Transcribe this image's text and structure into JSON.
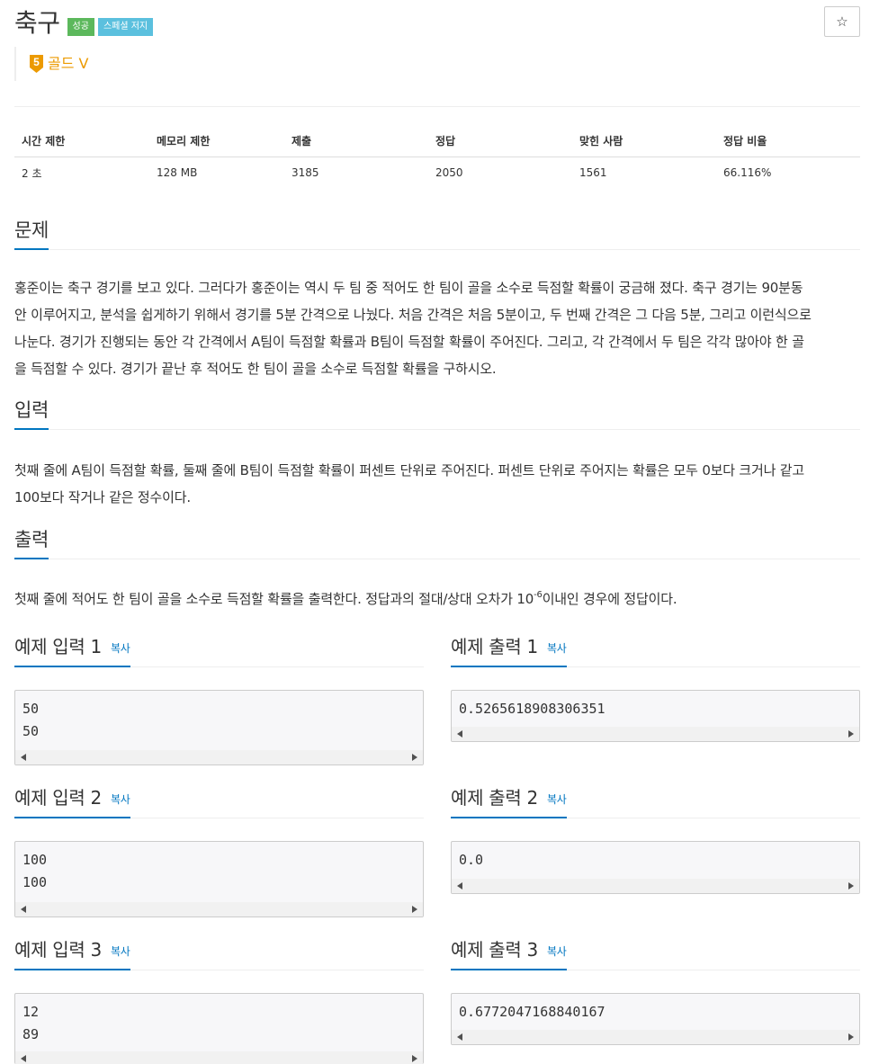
{
  "problem": {
    "title": "축구",
    "badges": {
      "success": "성공",
      "special": "스페셜 저지"
    },
    "tier": {
      "number": "5",
      "label": "골드 V",
      "color": "#ec9a00"
    },
    "star_label": "☆"
  },
  "info": {
    "headers": [
      "시간 제한",
      "메모리 제한",
      "제출",
      "정답",
      "맞힌 사람",
      "정답 비율"
    ],
    "values": [
      "2 초",
      "128 MB",
      "3185",
      "2050",
      "1561",
      "66.116%"
    ]
  },
  "sections": {
    "problem": {
      "title": "문제",
      "lines": [
        "홍준이는 축구 경기를 보고 있다. 그러다가 홍준이는 역시 두 팀 중 적어도 한 팀이 골을 소수로 득점할 확률이 궁금해 졌다. 축구 경기는 90분동",
        "안 이루어지고, 분석을 쉽게하기 위해서 경기를 5분 간격으로 나눴다. 처음 간격은 처음 5분이고, 두 번째 간격은 그 다음 5분, 그리고 이런식으로",
        "나눈다. 경기가 진행되는 동안 각 간격에서 A팀이 득점할 확률과 B팀이 득점할 확률이 주어진다. 그리고, 각 간격에서 두 팀은 각각 많아야 한 골",
        "을 득점할 수 있다. 경기가 끝난 후 적어도 한 팀이 골을 소수로 득점할 확률을 구하시오."
      ]
    },
    "input": {
      "title": "입력",
      "lines": [
        "첫째 줄에 A팀이 득점할 확률, 둘째 줄에 B팀이 득점할 확률이 퍼센트 단위로 주어진다. 퍼센트 단위로 주어지는 확률은 모두 0보다 크거나 같고",
        "100보다 작거나 같은 정수이다."
      ]
    },
    "output": {
      "title": "출력",
      "text_before": "첫째 줄에 적어도 한 팀이 골을 소수로 득점할 확률을 출력한다. 정답과의 절대/상대 오차가 10",
      "sup": "-6",
      "text_after": "이내인 경우에 정답이다."
    }
  },
  "samples": {
    "copy_label": "복사",
    "items": [
      {
        "input_title": "예제 입력 1",
        "output_title": "예제 출력 1",
        "input": "50\n50",
        "output": "0.5265618908306351"
      },
      {
        "input_title": "예제 입력 2",
        "output_title": "예제 출력 2",
        "input": "100\n100",
        "output": "0.0"
      },
      {
        "input_title": "예제 입력 3",
        "output_title": "예제 출력 3",
        "input": "12\n89",
        "output": "0.6772047168840167"
      }
    ]
  },
  "colors": {
    "accent": "#0076c0",
    "success": "#5cb85c",
    "special": "#5bc0de",
    "gold": "#ec9a00"
  }
}
